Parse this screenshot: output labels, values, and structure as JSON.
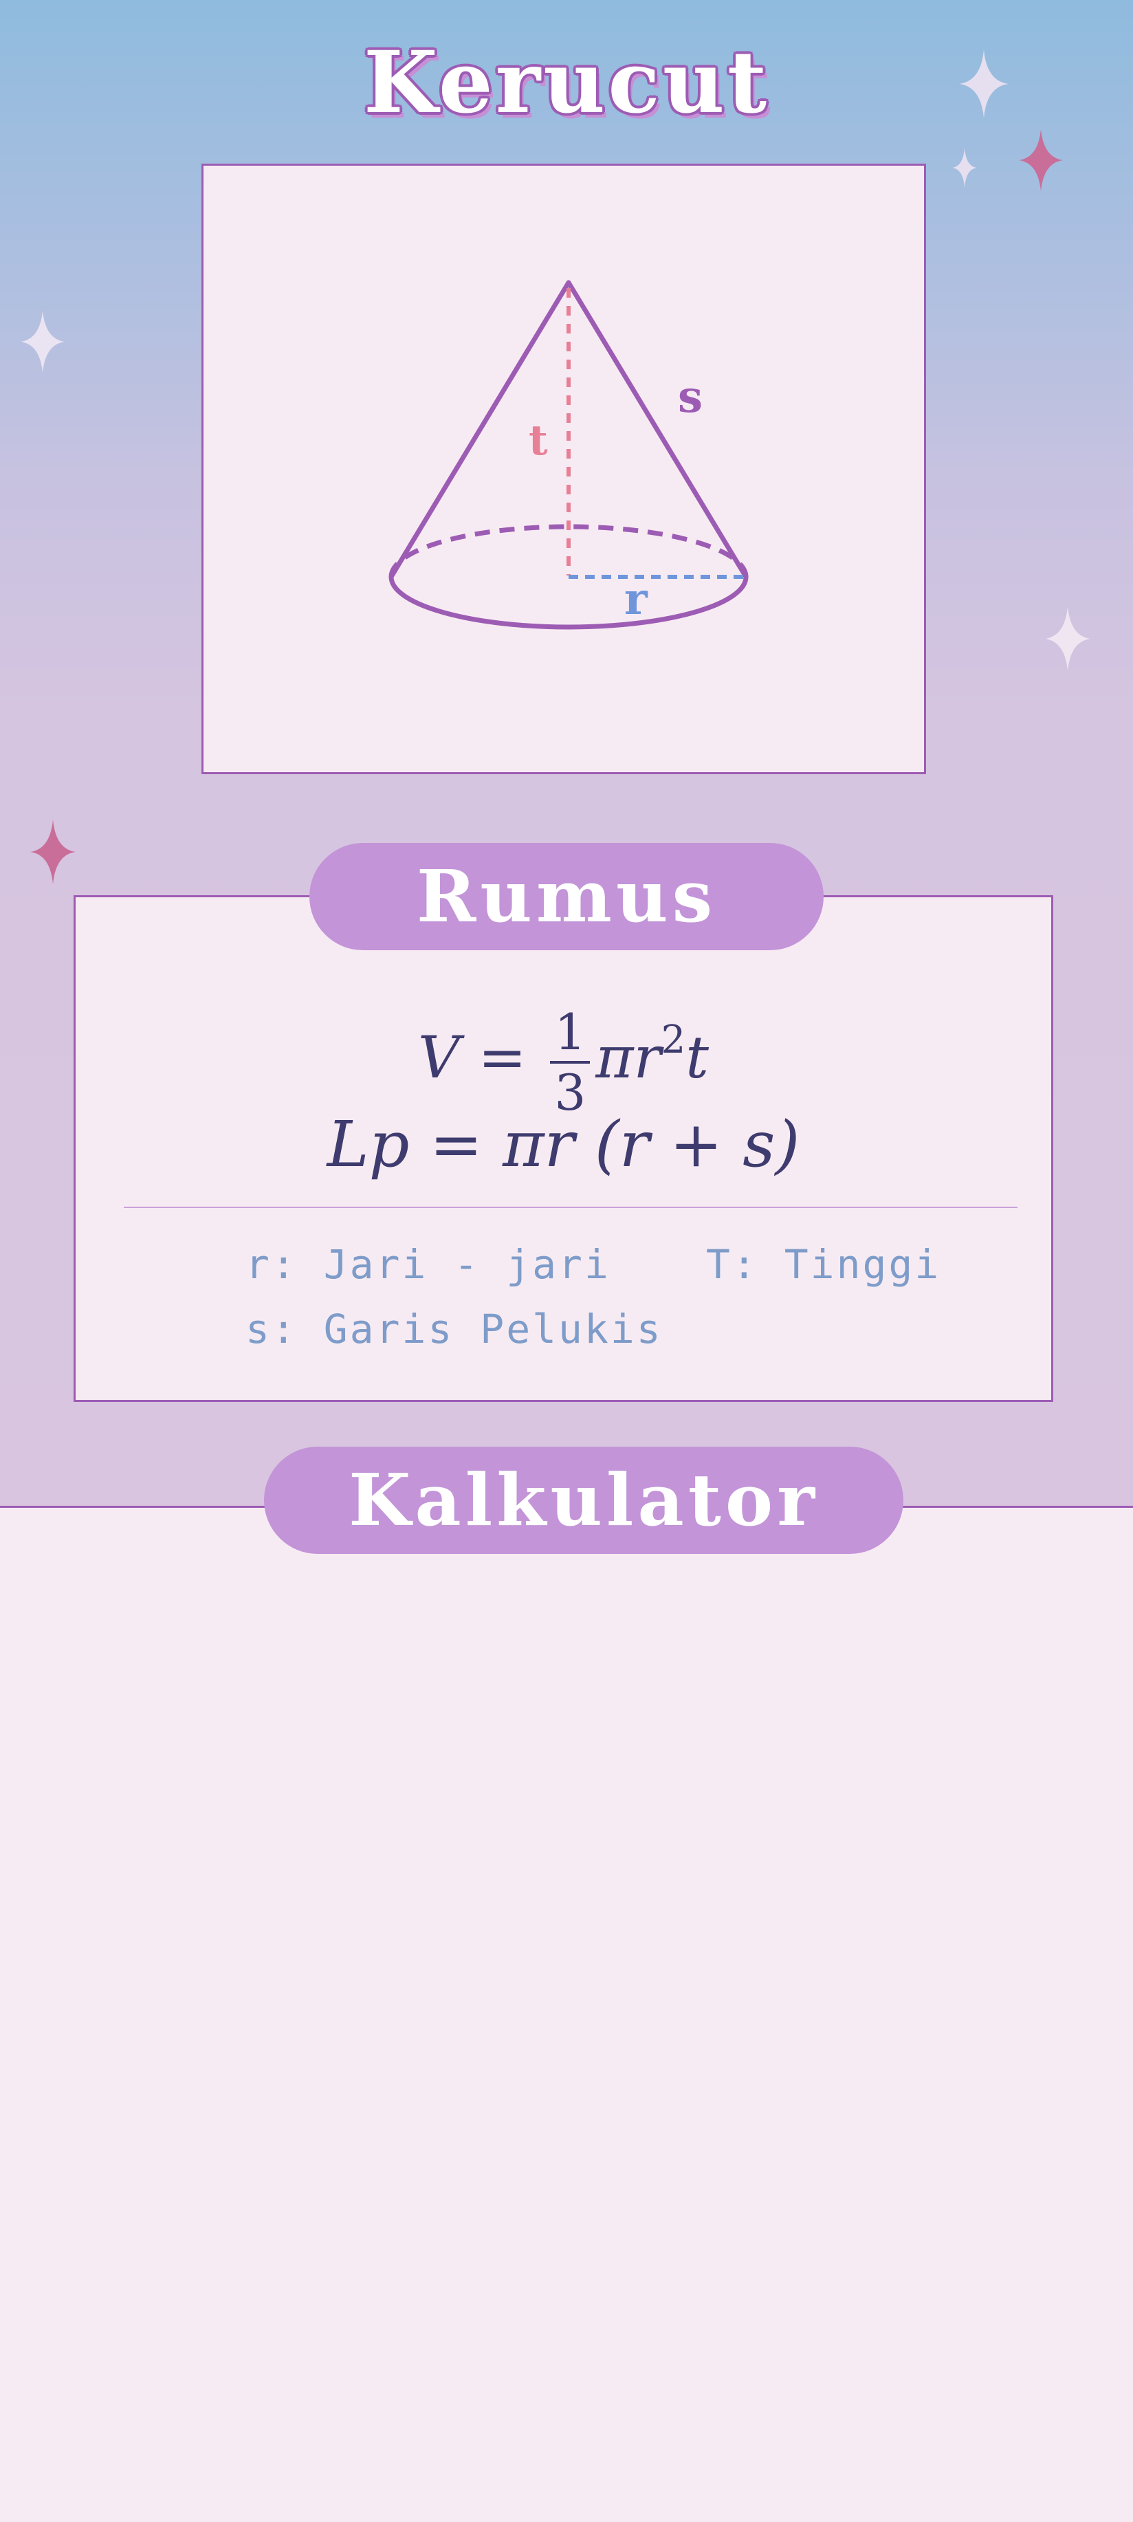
{
  "title": "Kerucut",
  "figure": {
    "labels": {
      "height": "t",
      "slant": "s",
      "radius": "r"
    }
  },
  "sections": {
    "formula_title": "Rumus",
    "calculator_title": "Kalkulator"
  },
  "formulas": {
    "volume": {
      "lhs": "V",
      "equals": "=",
      "numerator": "1",
      "denominator": "3",
      "rhs_main": "πr",
      "exponent": "2",
      "rhs_tail": "t"
    },
    "surface": {
      "lhs": "Lp",
      "equals": "=",
      "rhs": "πr (r + s)"
    }
  },
  "legend": {
    "r": "r: Jari - jari",
    "t": "T: Tinggi",
    "s": "s: Garis Pelukis"
  },
  "colors": {
    "accent_purple": "#9d5cb4",
    "pill_purple": "#c394d8",
    "height_pink": "#e77f96",
    "radius_blue": "#6f96db",
    "ink": "#3e3b6e",
    "legend_blue": "#7e9cc9",
    "panel_bg": "#f7ebf3"
  }
}
